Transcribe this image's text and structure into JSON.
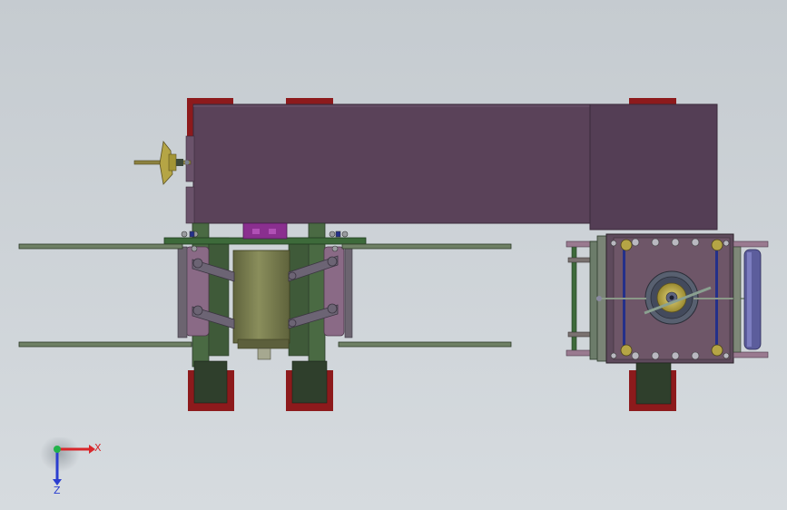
{
  "viewport": {
    "background_top": "#c5cbd0",
    "background_bottom": "#d6dbdf"
  },
  "model": {
    "colors": {
      "frame_purple": "#5a4259",
      "frame_purple_dark": "#4b3650",
      "foot_red": "#8d1a1c",
      "foot_dark": "#2f3f2c",
      "green_plate": "#3d6a3a",
      "green_dark": "#445a3a",
      "olive_column": "#767a4b",
      "rail_green": "#6e8064",
      "pink_plate": "#8a6a86",
      "gold": "#b5a545",
      "blue_accent": "#24308a",
      "roller_blue": "#5c5d9c"
    }
  },
  "triad": {
    "x_label": "X",
    "z_label": "Z",
    "x_color": "#d8262a",
    "y_color": "#22b34a",
    "z_color": "#2b3ed0"
  }
}
